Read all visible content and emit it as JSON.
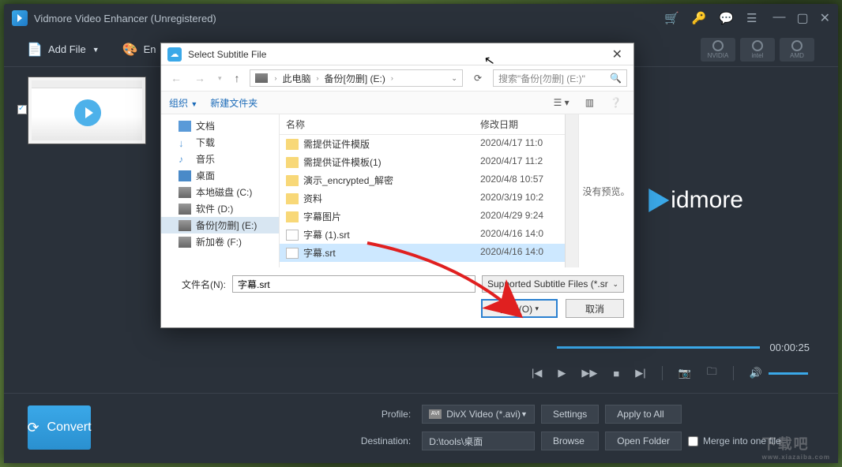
{
  "app": {
    "title": "Vidmore Video Enhancer (Unregistered)",
    "toolbar": {
      "add_file": "Add File",
      "enhance": "En"
    },
    "hw": [
      "NVIDIA",
      "intel",
      "AMD"
    ],
    "brand": "idmore",
    "time": "00:00:25",
    "bottom": {
      "profile_label": "Profile:",
      "profile_value": "DivX Video (*.avi)",
      "settings": "Settings",
      "apply_all": "Apply to All",
      "destination_label": "Destination:",
      "destination_value": "D:\\tools\\桌面",
      "browse": "Browse",
      "open_folder": "Open Folder",
      "merge": "Merge into one file",
      "convert": "Convert"
    }
  },
  "dialog": {
    "title": "Select Subtitle File",
    "path": {
      "seg1": "此电脑",
      "seg2": "备份[勿删] (E:)"
    },
    "search_placeholder": "搜索\"备份[勿删] (E:)\"",
    "organize": "组织",
    "new_folder": "新建文件夹",
    "tree": [
      {
        "label": "文档",
        "icon": "ti-doc"
      },
      {
        "label": "下载",
        "icon": "ti-dl",
        "glyph": "↓"
      },
      {
        "label": "音乐",
        "icon": "ti-music",
        "glyph": "♪"
      },
      {
        "label": "桌面",
        "icon": "ti-desk"
      },
      {
        "label": "本地磁盘 (C:)",
        "icon": "ti-drive"
      },
      {
        "label": "软件 (D:)",
        "icon": "ti-drive"
      },
      {
        "label": "备份[勿删] (E:)",
        "icon": "ti-drive",
        "selected": true
      },
      {
        "label": "新加卷 (F:)",
        "icon": "ti-drive"
      }
    ],
    "columns": {
      "name": "名称",
      "date": "修改日期"
    },
    "files": [
      {
        "name": "需提供证件模版",
        "type": "folder",
        "date": "2020/4/17 11:0"
      },
      {
        "name": "需提供证件模板(1)",
        "type": "folder",
        "date": "2020/4/17 11:2"
      },
      {
        "name": "演示_encrypted_解密",
        "type": "folder",
        "date": "2020/4/8 10:57"
      },
      {
        "name": "资料",
        "type": "folder",
        "date": "2020/3/19 10:2"
      },
      {
        "name": "字幕图片",
        "type": "folder",
        "date": "2020/4/29 9:24"
      },
      {
        "name": "字幕 (1).srt",
        "type": "file",
        "date": "2020/4/16 14:0"
      },
      {
        "name": "字幕.srt",
        "type": "file",
        "date": "2020/4/16 14:0",
        "selected": true
      }
    ],
    "preview_empty": "没有预览。",
    "filename_label": "文件名(N):",
    "filename_value": "字幕.srt",
    "filter": "Supported Subtitle Files (*.sr",
    "open": "打开(O)",
    "cancel": "取消"
  },
  "watermark": {
    "big": "下载吧",
    "small": "www.xiazaiba.com"
  }
}
